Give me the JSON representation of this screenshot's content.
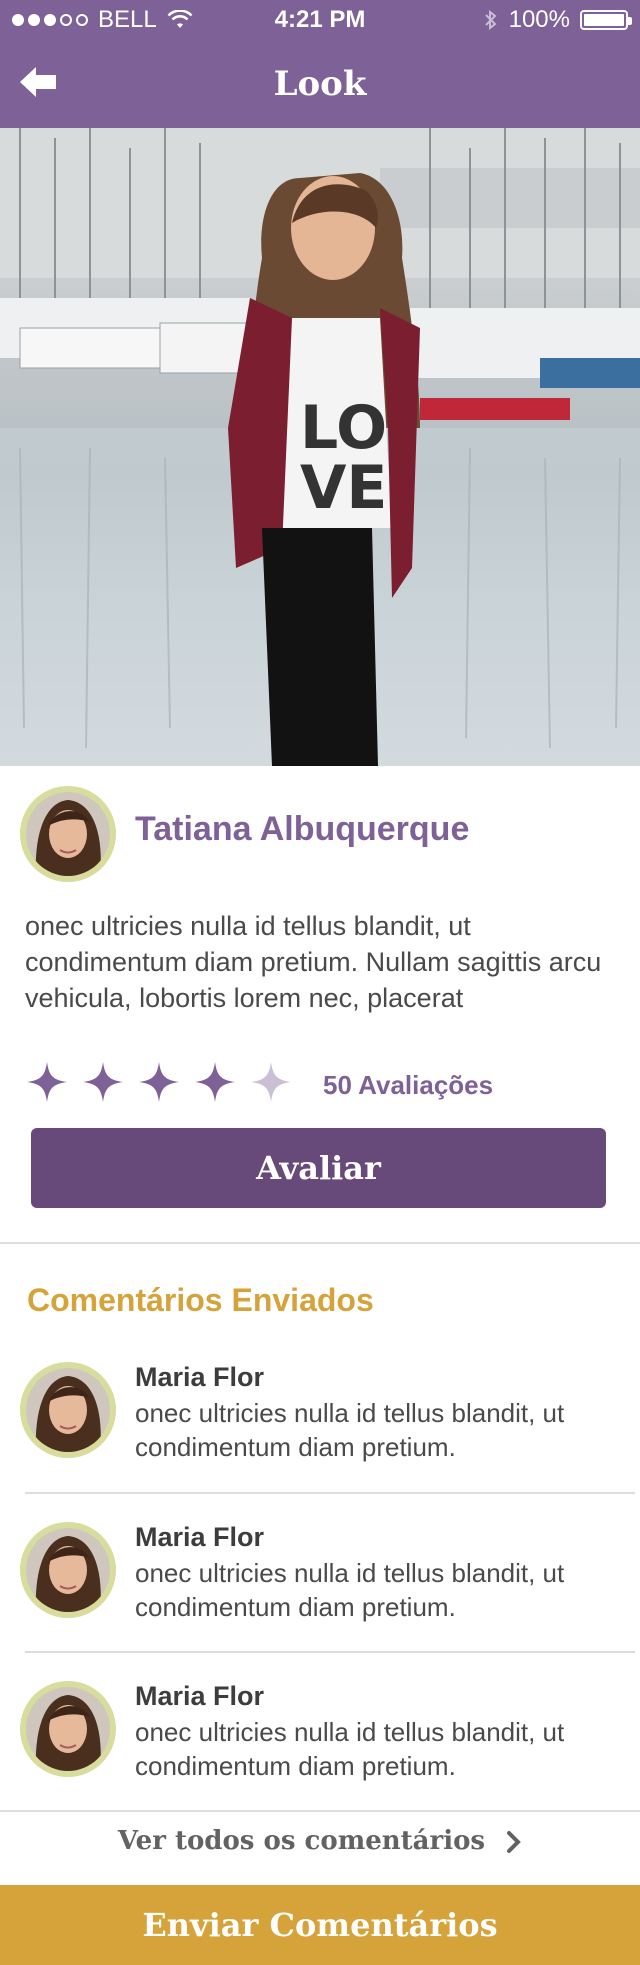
{
  "status_bar": {
    "carrier": "BELL",
    "time": "4:21 PM",
    "battery": "100%",
    "battery_level": 1.0,
    "signal_bars_filled": 3,
    "signal_bars_total": 5
  },
  "nav": {
    "title": "Look",
    "back_icon": "arrow-left-icon"
  },
  "author": {
    "name": "Tatiana Albuquerque",
    "description": "onec ultricies nulla id tellus blandit, ut condimentum diam pretium. Nullam sagittis arcu vehicula, lobortis lorem nec, placerat"
  },
  "rating": {
    "stars_filled": 4,
    "stars_total": 5,
    "count_label": "50 Avaliações",
    "button_label": "Avaliar"
  },
  "comments_section": {
    "title": "Comentários Enviados",
    "items": [
      {
        "name": "Maria Flor",
        "text": "onec ultricies nulla id tellus blandit, ut condimentum diam pretium."
      },
      {
        "name": "Maria Flor",
        "text": "onec ultricies nulla id tellus blandit, ut condimentum diam pretium."
      },
      {
        "name": "Maria Flor",
        "text": "onec ultricies nulla id tellus blandit, ut condimentum diam pretium."
      }
    ],
    "see_all_label": "Ver todos os comentários"
  },
  "footer": {
    "send_label": "Enviar Comentários"
  },
  "colors": {
    "header": "#7d6197",
    "accent_purple": "#674a7a",
    "accent_gold": "#d5a33a",
    "star_filled": "#7d6197",
    "star_empty": "#cbbfd6"
  }
}
